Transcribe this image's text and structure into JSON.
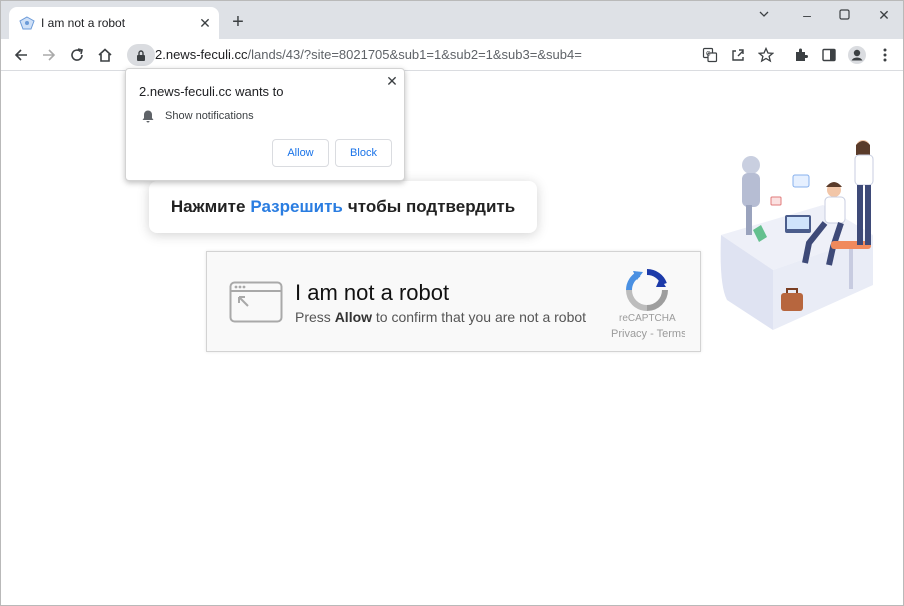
{
  "browser": {
    "tab": {
      "title": "I am not a robot"
    },
    "window_controls": {
      "minimize": "–",
      "maximize": "☐",
      "close": "✕"
    },
    "address": {
      "host": "2.news-feculi.cc",
      "path": "/lands/43/?site=8021705&sub1=1&sub2=1&sub3=&sub4="
    }
  },
  "notification_popup": {
    "title": "2.news-feculi.cc wants to",
    "permission": "Show notifications",
    "allow_label": "Allow",
    "block_label": "Block"
  },
  "instruction": {
    "prefix": "Нажмите",
    "highlight": "Разрешить",
    "suffix": "чтобы подтвердить",
    "highlight_color": "#2a7de1"
  },
  "captcha": {
    "title": "I am not a robot",
    "subtitle_prefix": "Press",
    "subtitle_bold": "Allow",
    "subtitle_suffix": "to confirm that you are not a robot",
    "brand": "reCAPTCHA",
    "links": "Privacy - Terms"
  },
  "icons": [
    "favicon-icon",
    "tab-close-icon",
    "new-tab-icon",
    "back-icon",
    "forward-icon",
    "reload-icon",
    "home-icon",
    "lock-icon",
    "translate-icon",
    "share-icon",
    "bookmark-star-icon",
    "extensions-icon",
    "side-panel-icon",
    "profile-icon",
    "menu-icon",
    "bell-icon",
    "recaptcha-logo-icon",
    "browser-window-icon"
  ]
}
